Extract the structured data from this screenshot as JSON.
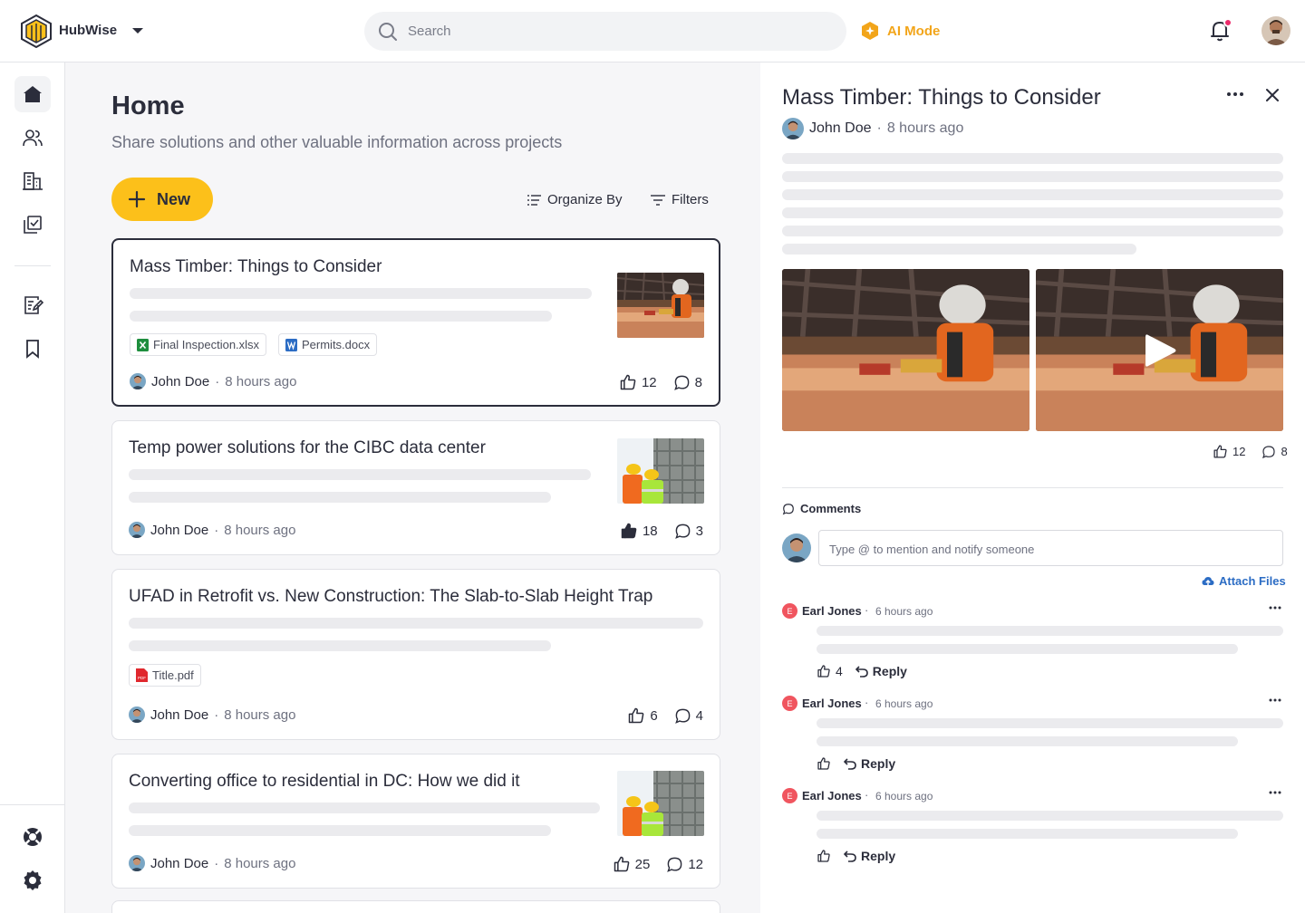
{
  "app": {
    "name": "HubWise"
  },
  "search": {
    "placeholder": "Search"
  },
  "ai_mode": {
    "label": "AI Mode",
    "color": "#f2a51a"
  },
  "colors": {
    "accent": "#fcc01a",
    "notification_dot": "#ec2a6a",
    "link": "#2b6cc4"
  },
  "sidebar": {
    "items": [
      {
        "name": "home",
        "icon": "home-icon",
        "active": true
      },
      {
        "name": "people",
        "icon": "users-icon"
      },
      {
        "name": "projects",
        "icon": "building-icon"
      },
      {
        "name": "tasks",
        "icon": "checklist-icon"
      },
      {
        "name": "notes",
        "icon": "edit-note-icon"
      },
      {
        "name": "saved",
        "icon": "bookmark-icon"
      }
    ],
    "bottom": [
      {
        "name": "help",
        "icon": "lifebuoy-icon"
      },
      {
        "name": "settings",
        "icon": "gear-icon"
      }
    ]
  },
  "main": {
    "title": "Home",
    "subtitle": "Share solutions and other valuable information across projects",
    "new_label": "New",
    "organize_label": "Organize By",
    "filters_label": "Filters"
  },
  "posts": [
    {
      "title": "Mass Timber: Things to Consider",
      "attachments": [
        {
          "name": "Final Inspection.xlsx",
          "type": "xlsx"
        },
        {
          "name": "Permits.docx",
          "type": "docx"
        }
      ],
      "author": "John Doe",
      "time": "8 hours ago",
      "likes": "12",
      "comments": "8",
      "liked": false,
      "selected": true
    },
    {
      "title": "Temp power solutions for the CIBC data center",
      "attachments": [],
      "author": "John Doe",
      "time": "8 hours ago",
      "likes": "18",
      "comments": "3",
      "liked": true
    },
    {
      "title": "UFAD in Retrofit vs. New Construction: The Slab-to-Slab Height Trap",
      "attachments": [
        {
          "name": "Title.pdf",
          "type": "pdf"
        }
      ],
      "author": "John Doe",
      "time": "8 hours ago",
      "likes": "6",
      "comments": "4",
      "liked": false
    },
    {
      "title": "Converting office to residential in DC: How we did it",
      "attachments": [],
      "author": "John Doe",
      "time": "8 hours ago",
      "likes": "25",
      "comments": "12",
      "liked": false
    }
  ],
  "detail": {
    "title": "Mass Timber: Things to Consider",
    "author": "John Doe",
    "time": "8 hours ago",
    "likes": "12",
    "comments": "8",
    "comments_heading": "Comments",
    "comment_placeholder": "Type @ to mention and notify someone",
    "attach_label": "Attach Files",
    "comment_list": [
      {
        "initial": "E",
        "author": "Earl Jones",
        "separator": "·",
        "time": "6 hours ago",
        "likes": "4",
        "reply": "Reply"
      },
      {
        "initial": "E",
        "author": "Earl Jones",
        "separator": "·",
        "time": "6 hours ago",
        "likes": "",
        "reply": "Reply"
      },
      {
        "initial": "E",
        "author": "Earl Jones",
        "separator": "·",
        "time": "6 hours ago",
        "likes": "",
        "reply": "Reply"
      }
    ]
  }
}
